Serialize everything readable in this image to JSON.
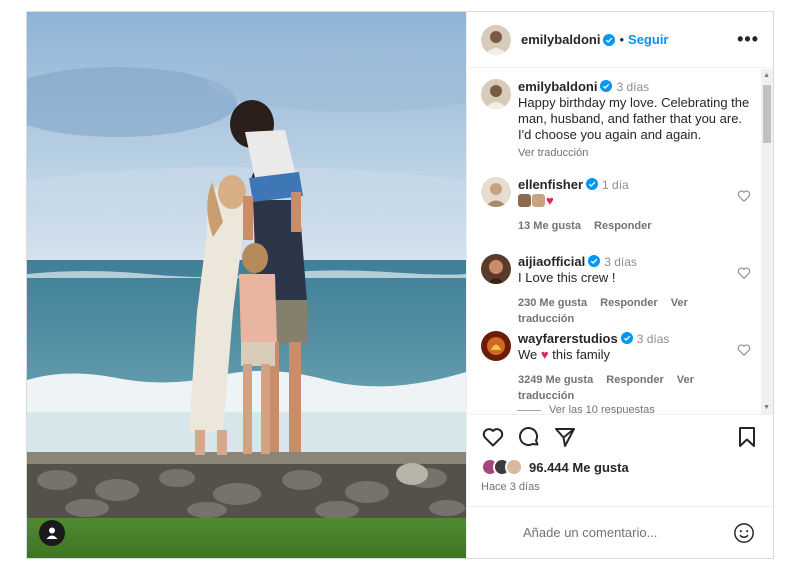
{
  "post": {
    "author": "emilybaldoni",
    "follow_label": "Seguir",
    "more_label": "•••",
    "dot": "•",
    "caption": {
      "username": "emilybaldoni",
      "time": "3 días",
      "text": "Happy birthday my love. Celebrating the man, husband, and father that you are. I'd choose you again and again.",
      "translate": "Ver traducción"
    },
    "comments": [
      {
        "username": "ellenfisher",
        "time": "1 día",
        "text": "",
        "likes": "13 Me gusta",
        "reply": "Responder",
        "translate": "",
        "emojis": [
          "#8b6a4f",
          "#c9a27e",
          "#e0245e"
        ]
      },
      {
        "username": "aijiaofficial",
        "time": "3 días",
        "text": "I Love this crew !",
        "likes": "230 Me gusta",
        "reply": "Responder",
        "translate": "Ver traducción"
      },
      {
        "username": "wayfarerstudios",
        "time": "3 días",
        "text_before": "We",
        "text_after": "this family",
        "likes": "3249 Me gusta",
        "reply": "Responder",
        "translate": "Ver traducción"
      }
    ],
    "view_replies": "Ver las 10 respuestas",
    "likes": "96.444 Me gusta",
    "posted": "Hace 3 días",
    "add_comment_placeholder": "Añade un comentario..."
  },
  "colors": {
    "accent": "#0095f6",
    "verified": "#0095f6",
    "heart": "#e0245e"
  },
  "icons": {
    "verified": "verified-badge-icon",
    "like": "heart-icon",
    "comment": "comment-icon",
    "share": "share-icon",
    "save": "bookmark-icon",
    "emoji": "emoji-icon",
    "tag": "user-tag-icon"
  }
}
